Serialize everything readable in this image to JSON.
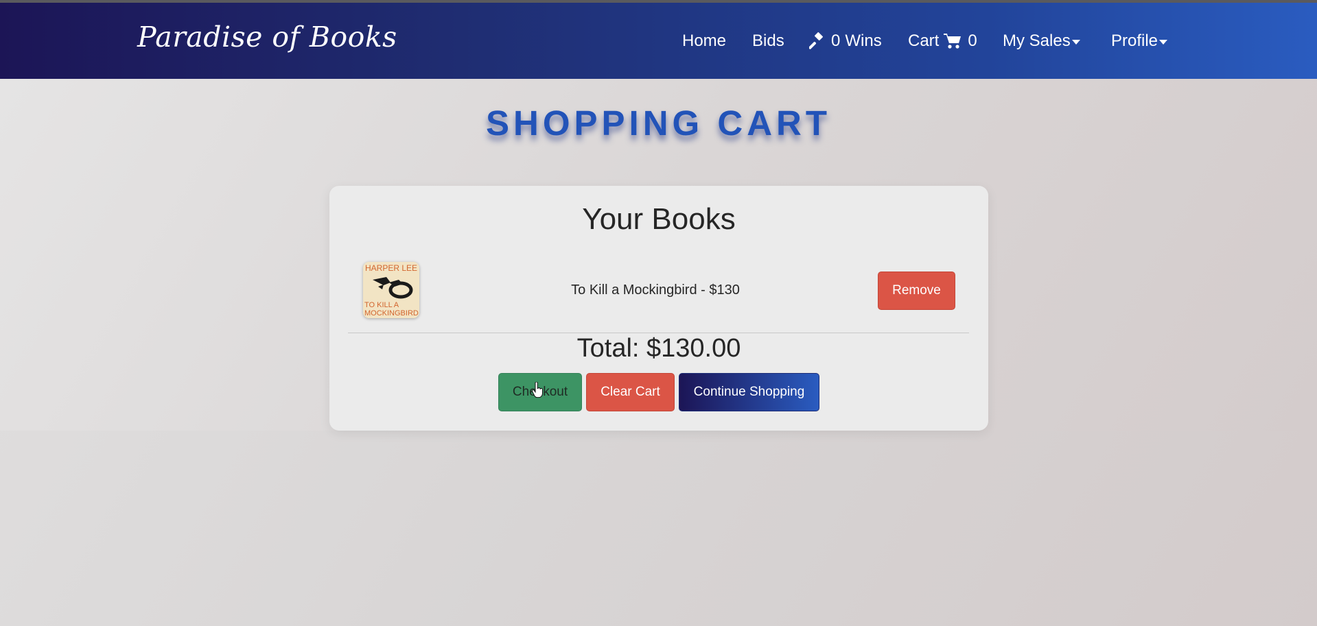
{
  "navbar": {
    "brand": "Paradise of Books",
    "links": {
      "home": "Home",
      "bids": "Bids",
      "wins_count": "0",
      "wins_label": "Wins",
      "cart_label": "Cart",
      "cart_count": "0",
      "my_sales": "My Sales",
      "profile": "Profile"
    },
    "icons": {
      "wins": "gavel-icon",
      "cart": "shopping-cart-icon",
      "dropdown": "caret-down-icon"
    }
  },
  "page": {
    "title": "SHOPPING CART"
  },
  "cart": {
    "heading": "Your Books",
    "items": [
      {
        "text": "To Kill a Mockingbird - $130",
        "cover": {
          "author": "HARPER LEE",
          "title_line1": "TO KILL A",
          "title_line2": "MOCKINGBIRD"
        },
        "remove_label": "Remove"
      }
    ],
    "total": "Total: $130.00",
    "buttons": {
      "checkout": "Checkout",
      "clear": "Clear Cart",
      "continue": "Continue Shopping"
    }
  },
  "colors": {
    "navbar_start": "#1c1556",
    "navbar_end": "#2a5cc0",
    "title_blue": "#2253b8",
    "danger": "#db5546",
    "success": "#3d9464"
  }
}
